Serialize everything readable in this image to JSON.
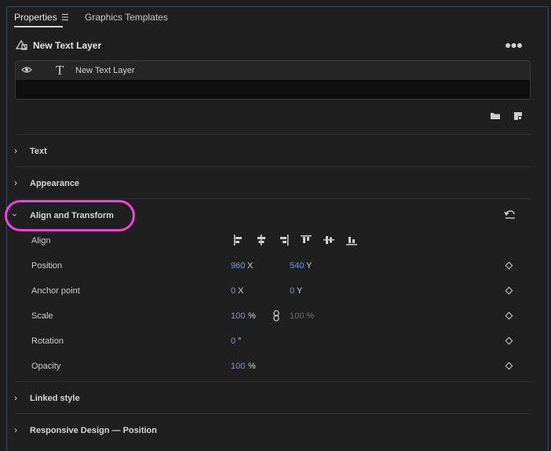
{
  "tabs": [
    {
      "label": "Properties",
      "active": true
    },
    {
      "label": "Graphics Templates",
      "active": false
    }
  ],
  "menu_icon": "hamburger-menu-icon",
  "layer_title": "New Text Layer",
  "layer_list": [
    {
      "label": "New Text Layer",
      "visible": true,
      "type_icon": "T"
    }
  ],
  "sections": {
    "text": "Text",
    "appearance": "Appearance",
    "align_transform": "Align and Transform",
    "linked_style": "Linked style",
    "responsive_design": "Responsive Design — Position"
  },
  "properties": {
    "align": {
      "label": "Align"
    },
    "position": {
      "label": "Position",
      "x": "960",
      "x_unit": "X",
      "y": "540",
      "y_unit": "Y"
    },
    "anchor": {
      "label": "Anchor point",
      "x": "0",
      "x_unit": "X",
      "y": "0",
      "y_unit": "Y"
    },
    "scale": {
      "label": "Scale",
      "value": "100",
      "unit": "%",
      "linked_value": "100 %"
    },
    "rotation": {
      "label": "Rotation",
      "value": "0",
      "unit": "°"
    },
    "opacity": {
      "label": "Opacity",
      "value": "100",
      "unit": "%"
    }
  },
  "colors": {
    "accent_value": "#5aa0f0",
    "highlight": "#ee44dd",
    "panel_bg": "#1f1f1f"
  }
}
